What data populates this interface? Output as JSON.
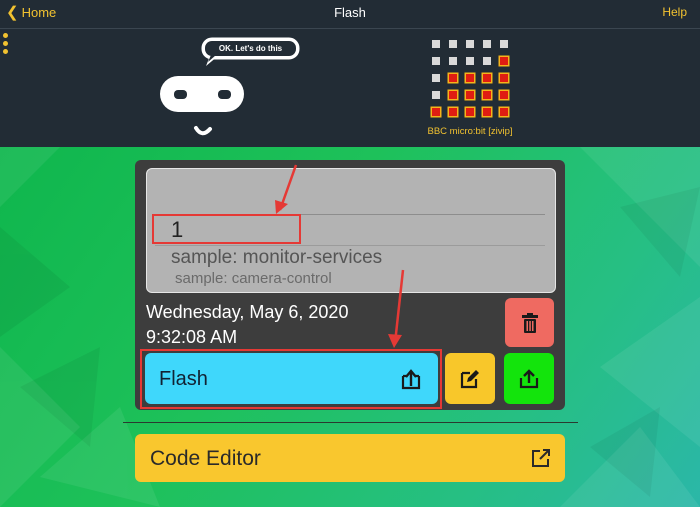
{
  "nav": {
    "back_label": "Home",
    "title": "Flash",
    "help_label": "Help"
  },
  "mascot": {
    "speech": "OK. Let's do this"
  },
  "device": {
    "name": "BBC micro:bit [zivip]",
    "led_rows": [
      [
        0,
        0,
        0,
        0,
        0
      ],
      [
        0,
        0,
        0,
        0,
        1
      ],
      [
        0,
        1,
        1,
        1,
        1
      ],
      [
        0,
        1,
        1,
        1,
        1
      ],
      [
        1,
        1,
        1,
        1,
        1
      ]
    ]
  },
  "project": {
    "preview": {
      "name": "1",
      "sample1": "sample: monitor-services",
      "sample2": "sample: camera-control"
    },
    "date": "Wednesday, May 6, 2020",
    "time": "9:32:08 AM"
  },
  "actions": {
    "flash_label": "Flash",
    "code_editor_label": "Code Editor"
  },
  "colors": {
    "accent": "#f2c230",
    "flash_button": "#3fd7fb",
    "edit_button": "#f8c72a",
    "share_button": "#13e40c",
    "delete_button": "#ef6a61",
    "annotation": "#e53935"
  },
  "icons": {
    "back": "chevron-left-icon",
    "menu": "more-vertical-icon",
    "delete": "trash-icon",
    "flash": "upload-icon",
    "edit": "edit-icon",
    "share": "share-icon",
    "open": "external-link-icon"
  }
}
